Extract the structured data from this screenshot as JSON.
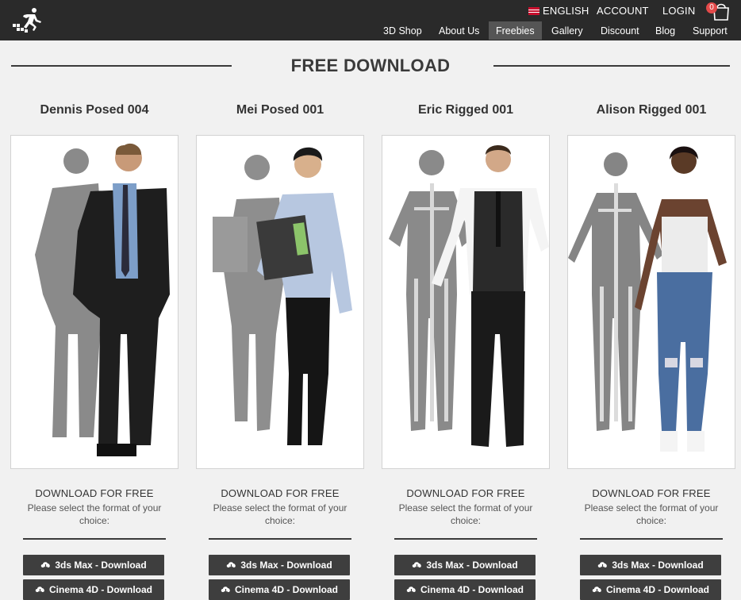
{
  "header": {
    "language": "ENGLISH",
    "account": "ACCOUNT",
    "login": "LOGIN",
    "cart_count": "0",
    "nav": [
      "3D Shop",
      "About Us",
      "Freebies",
      "Gallery",
      "Discount",
      "Blog",
      "Support"
    ],
    "active_nav": "Freebies"
  },
  "section": {
    "title": "FREE DOWNLOAD"
  },
  "cards": [
    {
      "name": "Dennis Posed 004",
      "download_title": "DOWNLOAD FOR FREE",
      "download_desc": "Please select the format of your choice:",
      "button_max": "3ds Max - Download",
      "button_c4d": "Cinema 4D - Download"
    },
    {
      "name": "Mei Posed 001",
      "download_title": "DOWNLOAD FOR FREE",
      "download_desc": "Please select the format of your choice:",
      "button_max": "3ds Max - Download",
      "button_c4d": "Cinema 4D - Download"
    },
    {
      "name": "Eric Rigged 001",
      "download_title": "DOWNLOAD FOR FREE",
      "download_desc": "Please select the format of your choice:",
      "button_max": "3ds Max - Download",
      "button_c4d": "Cinema 4D - Download"
    },
    {
      "name": "Alison Rigged 001",
      "download_title": "DOWNLOAD FOR FREE",
      "download_desc": "Please select the format of your choice:",
      "button_max": "3ds Max - Download",
      "button_c4d": "Cinema 4D - Download"
    }
  ],
  "colors": {
    "topbar": "#2a2a2a",
    "button": "#3e3e3e",
    "cart_badge": "#e34a4a",
    "background": "#f1f1f1"
  },
  "icons": {
    "logo": "runner-logo-icon",
    "cart": "shopping-bag-icon",
    "flag": "uk-flag-icon",
    "download": "cloud-download-icon"
  }
}
